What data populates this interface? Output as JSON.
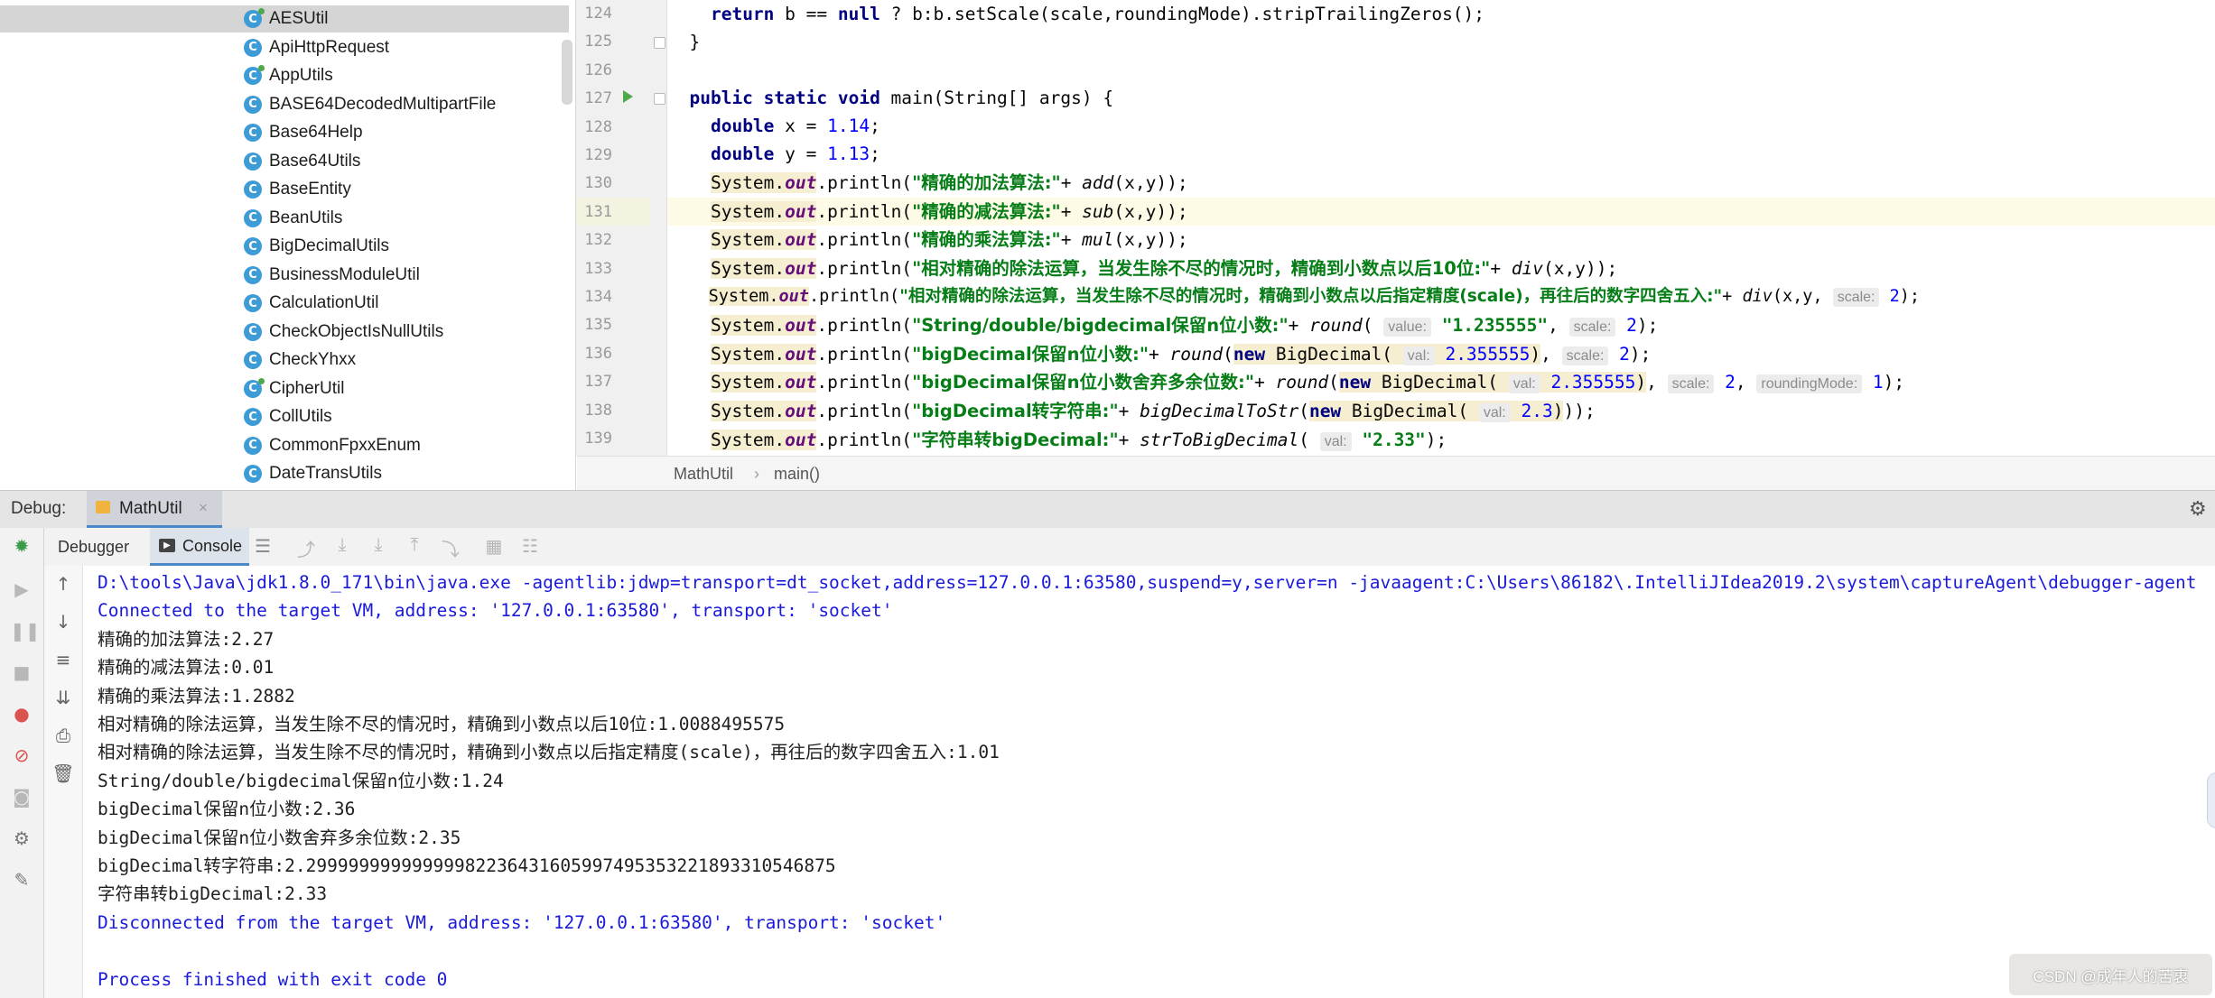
{
  "project_tree": {
    "items": [
      {
        "label": "AESUtil",
        "selected": true,
        "mark": true
      },
      {
        "label": "ApiHttpRequest"
      },
      {
        "label": "AppUtils",
        "mark": true
      },
      {
        "label": "BASE64DecodedMultipartFile"
      },
      {
        "label": "Base64Help"
      },
      {
        "label": "Base64Utils"
      },
      {
        "label": "BaseEntity"
      },
      {
        "label": "BeanUtils"
      },
      {
        "label": "BigDecimalUtils"
      },
      {
        "label": "BusinessModuleUtil"
      },
      {
        "label": "CalculationUtil"
      },
      {
        "label": "CheckObjectIsNullUtils"
      },
      {
        "label": "CheckYhxx"
      },
      {
        "label": "CipherUtil",
        "mark": true
      },
      {
        "label": "CollUtils"
      },
      {
        "label": "CommonFpxxEnum"
      },
      {
        "label": "DateTransUtils"
      }
    ],
    "icon_letter": "C"
  },
  "editor": {
    "line_numbers": [
      "124",
      "125",
      "126",
      "127",
      "128",
      "129",
      "130",
      "131",
      "132",
      "133",
      "134",
      "135",
      "136",
      "137",
      "138",
      "139"
    ],
    "code": {
      "l124_a": "return",
      "l124_b": " b == ",
      "l124_c": "null",
      "l124_d": " ? b:b.setScale(scale,roundingMode).stripTrailingZeros();",
      "l125": "}",
      "l127_a": "public static void",
      "l127_b": " main(String[] args) {",
      "l128_a": "double",
      "l128_b": " x = ",
      "l128_c": "1.14",
      "l128_d": ";",
      "l129_a": "double",
      "l129_b": " y = ",
      "l129_c": "1.13",
      "l129_d": ";",
      "sys": "System.",
      "out": "out",
      "println": ".println(",
      "plus": "+ ",
      "end": ");",
      "l130_str": "\"精确的加法算法:\"",
      "l130_fn": "add",
      "l130_args": "(x,y)",
      "l131_str": "\"精确的减法算法:\"",
      "l131_fn": "sub",
      "l131_args": "(x,y)",
      "l132_str": "\"精确的乘法算法:\"",
      "l132_fn": "mul",
      "l132_args": "(x,y)",
      "l133_str": "\"相对精确的除法运算，当发生除不尽的情况时，精确到小数点以后10位:\"",
      "l133_fn": "div",
      "l133_args": "(x,y)",
      "l134_str": "\"相对精确的除法运算，当发生除不尽的情况时，精确到小数点以后指定精度(scale)，再往后的数字四舍五入:\"",
      "l134_fn": "div",
      "l134_args": "(x,y, ",
      "l134_hint": "scale:",
      "l134_val": "2",
      "l135_str": "\"String/double/bigdecimal保留n位小数:\"",
      "l135_fn": "round",
      "l135_hint1": "value:",
      "l135_val1": "\"1.235555\"",
      "l135_hint2": "scale:",
      "l135_val2": "2",
      "l136_str": "\"bigDecimal保留n位小数:\"",
      "l136_fn": "round",
      "new_kw": "new",
      "bigdec": " BigDecimal(",
      "l136_hint1": "val:",
      "l136_val1": "2.355555",
      "l136_hint2": "scale:",
      "l136_val2": "2",
      "l137_str": "\"bigDecimal保留n位小数舍弃多余位数:\"",
      "l137_fn": "round",
      "l137_hint1": "val:",
      "l137_val1": "2.355555",
      "l137_hint2": "scale:",
      "l137_val2": "2",
      "l137_hint3": "roundingMode:",
      "l137_val3": "1",
      "l138_str": "\"bigDecimal转字符串:\"",
      "l138_fn": "bigDecimalToStr",
      "l138_hint1": "val:",
      "l138_val1": "2.3",
      "l139_str": "\"字符串转bigDecimal:\"",
      "l139_fn": "strToBigDecimal",
      "l139_hint1": "val:",
      "l139_val1": "\"2.33\""
    },
    "breadcrumb": [
      "MathUtil",
      "main()"
    ]
  },
  "debug": {
    "label": "Debug:",
    "session_tab": "MathUtil",
    "tabs": [
      "Debugger",
      "Console"
    ]
  },
  "console": {
    "lines": [
      {
        "text": "D:\\tools\\Java\\jdk1.8.0_171\\bin\\java.exe -agentlib:jdwp=transport=dt_socket,address=127.0.0.1:63580,suspend=y,server=n -javaagent:C:\\Users\\86182\\.IntelliJIdea2019.2\\system\\captureAgent\\debugger-agent",
        "blue": true
      },
      {
        "text": "Connected to the target VM, address: '127.0.0.1:63580', transport: 'socket'",
        "blue": true
      },
      {
        "text": "精确的加法算法:2.27"
      },
      {
        "text": "精确的减法算法:0.01"
      },
      {
        "text": "精确的乘法算法:1.2882"
      },
      {
        "text": "相对精确的除法运算，当发生除不尽的情况时，精确到小数点以后10位:1.0088495575"
      },
      {
        "text": "相对精确的除法运算，当发生除不尽的情况时，精确到小数点以后指定精度(scale)，再往后的数字四舍五入:1.01"
      },
      {
        "text": "String/double/bigdecimal保留n位小数:1.24"
      },
      {
        "text": "bigDecimal保留n位小数:2.36"
      },
      {
        "text": "bigDecimal保留n位小数舍弃多余位数:2.35"
      },
      {
        "text": "bigDecimal转字符串:2.29999999999999982236431605997495353221893310546875"
      },
      {
        "text": "字符串转bigDecimal:2.33"
      },
      {
        "text": "Disconnected from the target VM, address: '127.0.0.1:63580', transport: 'socket'",
        "blue": true
      },
      {
        "text": ""
      },
      {
        "text": "Process finished with exit code 0",
        "blue": true
      }
    ]
  },
  "watermark": "CSDN @成年人的苦衷"
}
